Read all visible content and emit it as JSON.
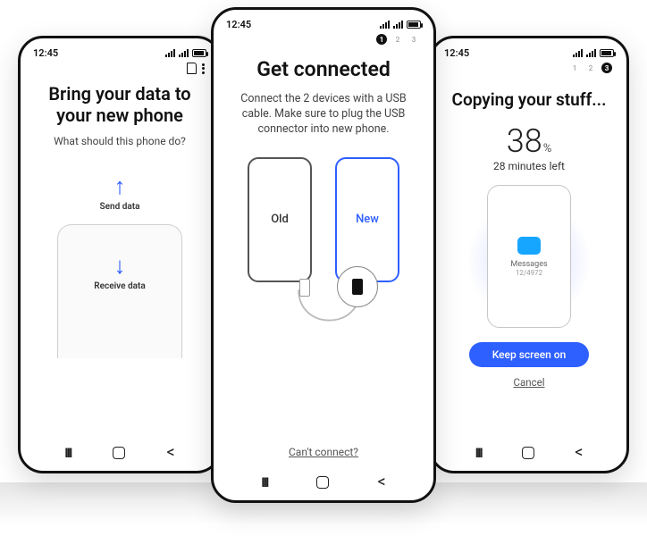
{
  "status_time": "12:45",
  "left": {
    "title_l1": "Bring your data to",
    "title_l2": "your new phone",
    "subtitle": "What should this phone do?",
    "send_label": "Send data",
    "receive_label": "Receive data"
  },
  "center": {
    "steps": [
      "1",
      "2",
      "3"
    ],
    "title": "Get connected",
    "subtitle": "Connect the 2 devices with a USB cable. Make sure to plug the USB connector into new phone.",
    "old_label": "Old",
    "new_label": "New",
    "help_link": "Can't connect?"
  },
  "right": {
    "steps": [
      "1",
      "2",
      "3"
    ],
    "title": "Copying your stuff...",
    "percent": "38",
    "percent_unit": "%",
    "eta": "28 minutes left",
    "item_label": "Messages",
    "item_count": "12/4972",
    "keep_btn": "Keep screen on",
    "cancel": "Cancel"
  }
}
